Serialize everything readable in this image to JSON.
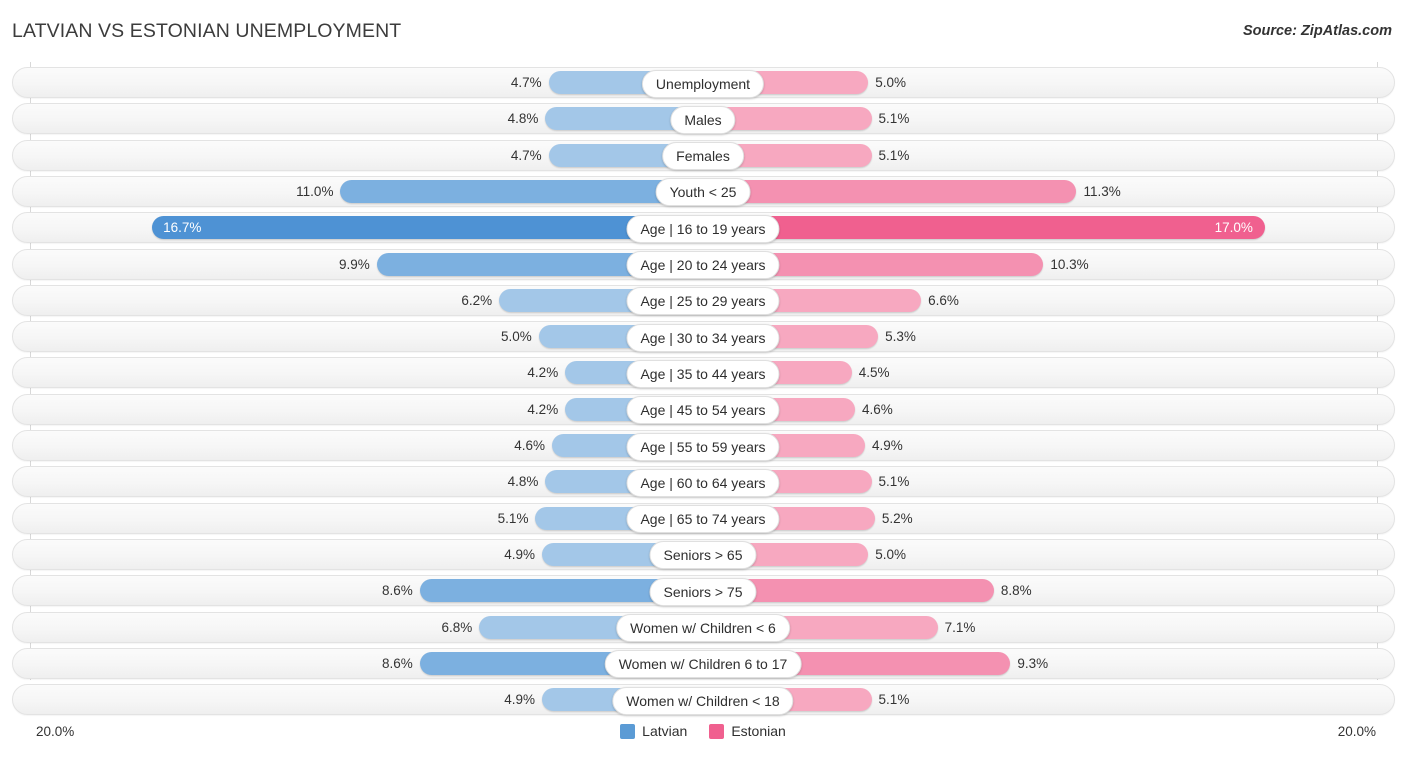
{
  "header": {
    "title": "LATVIAN VS ESTONIAN UNEMPLOYMENT",
    "source": "Source: ZipAtlas.com"
  },
  "footer": {
    "axis_left": "20.0%",
    "axis_right": "20.0%",
    "legend": [
      {
        "label": "Latvian",
        "color": "#5b9bd5"
      },
      {
        "label": "Estonian",
        "color": "#f0608f"
      }
    ]
  },
  "chart_data": {
    "type": "bar",
    "subtype": "diverging-butterfly",
    "title": "LATVIAN VS ESTONIAN UNEMPLOYMENT",
    "xlabel": "",
    "ylabel": "",
    "axis_max": 20.0,
    "axis_left_label": "20.0%",
    "axis_right_label": "20.0%",
    "grid": true,
    "legend_position": "bottom-center",
    "categories": [
      "Unemployment",
      "Males",
      "Females",
      "Youth < 25",
      "Age | 16 to 19 years",
      "Age | 20 to 24 years",
      "Age | 25 to 29 years",
      "Age | 30 to 34 years",
      "Age | 35 to 44 years",
      "Age | 45 to 54 years",
      "Age | 55 to 59 years",
      "Age | 60 to 64 years",
      "Age | 65 to 74 years",
      "Seniors > 65",
      "Seniors > 75",
      "Women w/ Children < 6",
      "Women w/ Children 6 to 17",
      "Women w/ Children < 18"
    ],
    "series": [
      {
        "name": "Latvian",
        "color": "#a3c7e8",
        "values": [
          4.7,
          4.8,
          4.7,
          11.0,
          16.7,
          9.9,
          6.2,
          5.0,
          4.2,
          4.2,
          4.6,
          4.8,
          5.1,
          4.9,
          8.6,
          6.8,
          8.6,
          4.9
        ],
        "labels": [
          "4.7%",
          "4.8%",
          "4.7%",
          "11.0%",
          "16.7%",
          "9.9%",
          "6.2%",
          "5.0%",
          "4.2%",
          "4.2%",
          "4.6%",
          "4.8%",
          "5.1%",
          "4.9%",
          "8.6%",
          "6.8%",
          "8.6%",
          "4.9%"
        ]
      },
      {
        "name": "Estonian",
        "color": "#f7a8c0",
        "values": [
          5.0,
          5.1,
          5.1,
          11.3,
          17.0,
          10.3,
          6.6,
          5.3,
          4.5,
          4.6,
          4.9,
          5.1,
          5.2,
          5.0,
          8.8,
          7.1,
          9.3,
          5.1
        ],
        "labels": [
          "5.0%",
          "5.1%",
          "5.1%",
          "11.3%",
          "17.0%",
          "10.3%",
          "6.6%",
          "5.3%",
          "4.5%",
          "4.6%",
          "4.9%",
          "5.1%",
          "5.2%",
          "5.0%",
          "8.8%",
          "7.1%",
          "9.3%",
          "5.1%"
        ]
      }
    ],
    "rows": [
      {
        "label": "Unemployment",
        "left": 4.7,
        "left_label": "4.7%",
        "right": 5.0,
        "right_label": "5.0%",
        "emphasis": 0
      },
      {
        "label": "Males",
        "left": 4.8,
        "left_label": "4.8%",
        "right": 5.1,
        "right_label": "5.1%",
        "emphasis": 0
      },
      {
        "label": "Females",
        "left": 4.7,
        "left_label": "4.7%",
        "right": 5.1,
        "right_label": "5.1%",
        "emphasis": 0
      },
      {
        "label": "Youth < 25",
        "left": 11.0,
        "left_label": "11.0%",
        "right": 11.3,
        "right_label": "11.3%",
        "emphasis": 1
      },
      {
        "label": "Age | 16 to 19 years",
        "left": 16.7,
        "left_label": "16.7%",
        "right": 17.0,
        "right_label": "17.0%",
        "emphasis": 2
      },
      {
        "label": "Age | 20 to 24 years",
        "left": 9.9,
        "left_label": "9.9%",
        "right": 10.3,
        "right_label": "10.3%",
        "emphasis": 1
      },
      {
        "label": "Age | 25 to 29 years",
        "left": 6.2,
        "left_label": "6.2%",
        "right": 6.6,
        "right_label": "6.6%",
        "emphasis": 0
      },
      {
        "label": "Age | 30 to 34 years",
        "left": 5.0,
        "left_label": "5.0%",
        "right": 5.3,
        "right_label": "5.3%",
        "emphasis": 0
      },
      {
        "label": "Age | 35 to 44 years",
        "left": 4.2,
        "left_label": "4.2%",
        "right": 4.5,
        "right_label": "4.5%",
        "emphasis": 0
      },
      {
        "label": "Age | 45 to 54 years",
        "left": 4.2,
        "left_label": "4.2%",
        "right": 4.6,
        "right_label": "4.6%",
        "emphasis": 0
      },
      {
        "label": "Age | 55 to 59 years",
        "left": 4.6,
        "left_label": "4.6%",
        "right": 4.9,
        "right_label": "4.9%",
        "emphasis": 0
      },
      {
        "label": "Age | 60 to 64 years",
        "left": 4.8,
        "left_label": "4.8%",
        "right": 5.1,
        "right_label": "5.1%",
        "emphasis": 0
      },
      {
        "label": "Age | 65 to 74 years",
        "left": 5.1,
        "left_label": "5.1%",
        "right": 5.2,
        "right_label": "5.2%",
        "emphasis": 0
      },
      {
        "label": "Seniors > 65",
        "left": 4.9,
        "left_label": "4.9%",
        "right": 5.0,
        "right_label": "5.0%",
        "emphasis": 0
      },
      {
        "label": "Seniors > 75",
        "left": 8.6,
        "left_label": "8.6%",
        "right": 8.8,
        "right_label": "8.8%",
        "emphasis": 1
      },
      {
        "label": "Women w/ Children < 6",
        "left": 6.8,
        "left_label": "6.8%",
        "right": 7.1,
        "right_label": "7.1%",
        "emphasis": 0
      },
      {
        "label": "Women w/ Children 6 to 17",
        "left": 8.6,
        "left_label": "8.6%",
        "right": 9.3,
        "right_label": "9.3%",
        "emphasis": 1
      },
      {
        "label": "Women w/ Children < 18",
        "left": 4.9,
        "left_label": "4.9%",
        "right": 5.1,
        "right_label": "5.1%",
        "emphasis": 0
      }
    ]
  }
}
